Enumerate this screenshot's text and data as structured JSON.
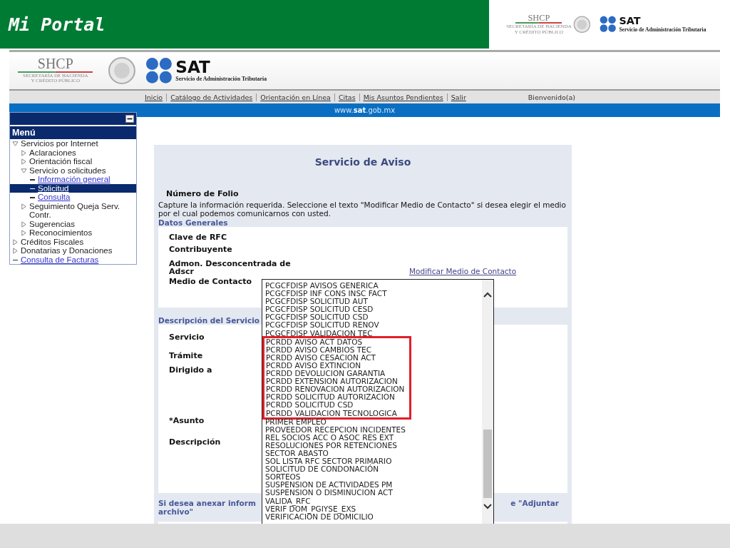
{
  "slide_title": "Mi Portal",
  "slide_logos": {
    "shcp": "SHCP",
    "shcp_sub": [
      "SECRETARÍA DE HACIENDA",
      "Y CRÉDITO PÚBLICO"
    ],
    "sat": "SAT",
    "sat_sub": "Servicio de Administración Tributaria"
  },
  "site_logos": {
    "shcp": "SHCP",
    "shcp_sub": [
      "SECRETARÍA DE HACIENDA",
      "Y CRÉDITO PÚBLICO"
    ],
    "sat": "SAT",
    "sat_sub": "Servicio de Administración Tributaria"
  },
  "nav": {
    "links": [
      "Inicio",
      "Catálogo de Actividades",
      "Orientación en Línea",
      "Citas",
      "Mis Asuntos Pendientes",
      "Salir"
    ],
    "greeting": "Bienvenido(a)"
  },
  "url_bar": {
    "prefix": "www.",
    "domain": "sat",
    "suffix": ".gob.mx"
  },
  "menu": {
    "title": "Menú",
    "items": [
      {
        "label": "Servicios por Internet",
        "kind": "folder",
        "expanded": true,
        "selected": false,
        "children": [
          {
            "label": "Aclaraciones",
            "kind": "folder",
            "expanded": false,
            "selected": false
          },
          {
            "label": "Orientación fiscal",
            "kind": "folder",
            "expanded": false,
            "selected": false
          },
          {
            "label": "Servicio o solicitudes",
            "kind": "folder",
            "expanded": true,
            "selected": false,
            "children": [
              {
                "label": "Información general",
                "kind": "link",
                "selected": false
              },
              {
                "label": "Solicitud",
                "kind": "link",
                "selected": true
              },
              {
                "label": "Consulta",
                "kind": "link",
                "selected": false
              }
            ]
          },
          {
            "label": "Seguimiento Queja Serv. Contr.",
            "kind": "folder",
            "expanded": false,
            "selected": false
          },
          {
            "label": "Sugerencias",
            "kind": "folder",
            "expanded": false,
            "selected": false
          },
          {
            "label": "Reconocimientos",
            "kind": "folder",
            "expanded": false,
            "selected": false
          }
        ]
      },
      {
        "label": "Créditos Fiscales",
        "kind": "folder",
        "expanded": false,
        "selected": false
      },
      {
        "label": "Donatarias y Donaciones",
        "kind": "folder",
        "expanded": false,
        "selected": false
      },
      {
        "label": "Consulta de Facturas",
        "kind": "link",
        "selected": false
      }
    ]
  },
  "form": {
    "title": "Servicio de Aviso",
    "folio_label": "Número de Folio",
    "instructions": "Capture la información requerida. Seleccione el texto \"Modificar Medio de Contacto\" si desea elegir el medio por el cual podemos comunicarnos con usted.",
    "general": {
      "heading": "Datos Generales",
      "fields": [
        "Clave de RFC",
        "Contribuyente",
        "Admon. Desconcentrada de\nAdscr",
        "Medio de Contacto"
      ],
      "contact_link": "Modificar Medio de Contacto"
    },
    "service": {
      "heading": "Descripción del Servicio",
      "fields": [
        "Servicio",
        "Trámite",
        "Dirigido a",
        "*Asunto",
        "Descripción"
      ]
    },
    "attach_note": {
      "left": "Si desea anexar inform",
      "right": "e \"Adjuntar",
      "second_line": "archivo\""
    }
  },
  "dropdown": {
    "options": [
      {
        "label": "PCGCFDISP AVISOS GENERICA",
        "marked": false
      },
      {
        "label": "PCGCFDISP INF CONS INSC FACT",
        "marked": false
      },
      {
        "label": "PCGCFDISP SOLICITUD AUT",
        "marked": false
      },
      {
        "label": "PCGCFDISP SOLICITUD CESD",
        "marked": false
      },
      {
        "label": "PCGCFDISP SOLICITUD CSD",
        "marked": false
      },
      {
        "label": "PCGCFDISP SOLICITUD RENOV",
        "marked": false
      },
      {
        "label": "PCGCFDISP VALIDACION TEC",
        "marked": false
      },
      {
        "label": "PCRDD AVISO ACT DATOS",
        "marked": true
      },
      {
        "label": "PCRDD AVISO CAMBIOS TEC",
        "marked": true
      },
      {
        "label": "PCRDD AVISO CESACION ACT",
        "marked": true
      },
      {
        "label": "PCRDD AVISO EXTINCION",
        "marked": true
      },
      {
        "label": "PCRDD DEVOLUCION GARANTIA",
        "marked": true
      },
      {
        "label": "PCRDD EXTENSION AUTORIZACION",
        "marked": true
      },
      {
        "label": "PCRDD RENOVACION AUTORIZACION",
        "marked": true
      },
      {
        "label": "PCRDD SOLICITUD AUTORIZACION",
        "marked": true
      },
      {
        "label": "PCRDD SOLICITUD CSD",
        "marked": true
      },
      {
        "label": "PCRDD VALIDACION TECNOLOGICA",
        "marked": true
      },
      {
        "label": "PRIMER EMPLEO",
        "marked": false
      },
      {
        "label": "PROVEEDOR RECEPCION INCIDENTES",
        "marked": false
      },
      {
        "label": "REL SOCIOS ACC O ASOC RES EXT",
        "marked": false
      },
      {
        "label": "RESOLUCIONES POR RETENCIONES",
        "marked": false
      },
      {
        "label": "SECTOR ABASTO",
        "marked": false
      },
      {
        "label": "SOL LISTA RFC SECTOR PRIMARIO",
        "marked": false
      },
      {
        "label": "SOLICITUD DE CONDONACIÓN",
        "marked": false
      },
      {
        "label": "SORTEOS",
        "marked": false
      },
      {
        "label": "SUSPENSION DE ACTIVIDADES PM",
        "marked": false
      },
      {
        "label": "SUSPENSION O DISMINUCION ACT",
        "marked": false
      },
      {
        "label": "VALIDA_RFC",
        "marked": false
      },
      {
        "label": "VERIF DOM_PGIYSE_EXS",
        "marked": false
      },
      {
        "label": "VERIFICACION DE DOMICILIO",
        "marked": false
      }
    ]
  }
}
